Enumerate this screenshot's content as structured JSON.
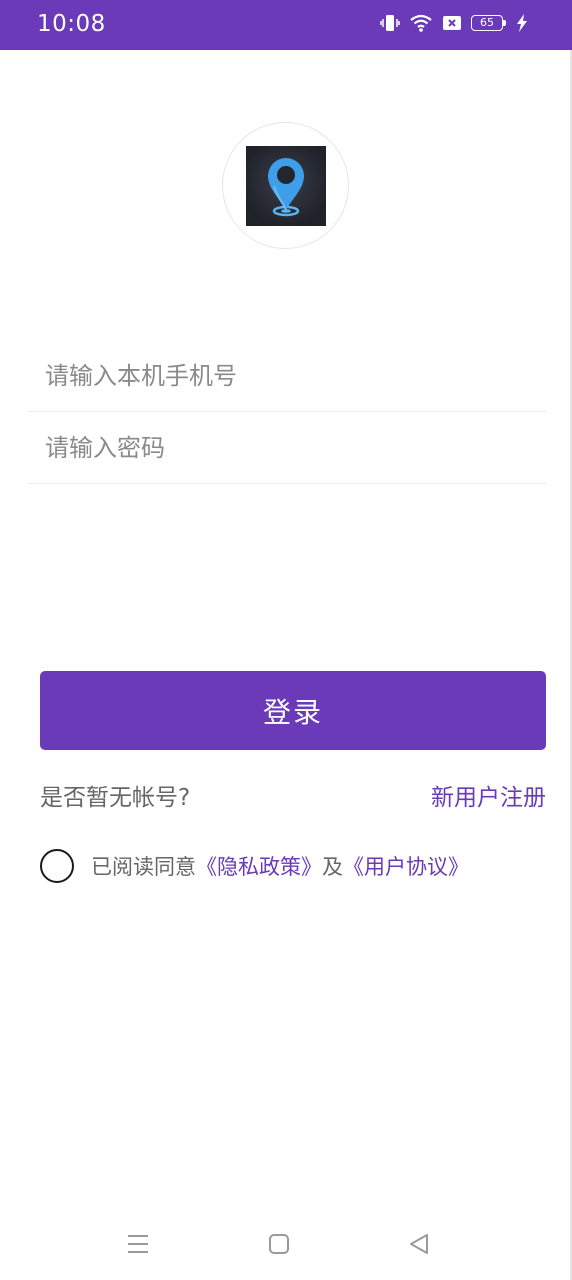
{
  "status_bar": {
    "time": "10:08",
    "battery_level": "65",
    "icons": [
      "vibrate-icon",
      "wifi-icon",
      "sim-off-icon",
      "battery-icon",
      "charging-icon"
    ]
  },
  "logo": {
    "icon": "location-pin-icon"
  },
  "form": {
    "phone_placeholder": "请输入本机手机号",
    "password_placeholder": "请输入密码"
  },
  "login_label": "登录",
  "no_account_text": "是否暂无帐号?",
  "register_label": "新用户注册",
  "agreement": {
    "prefix": "已阅读同意",
    "privacy_link": "《隐私政策》",
    "conjunction": "及",
    "terms_link": "《用户协议》",
    "checked": false
  },
  "nav_bar": {
    "icons": [
      "menu-icon",
      "home-icon",
      "back-icon"
    ]
  },
  "colors": {
    "accent": "#6a3ab8",
    "status_bar": "#6a3ab8"
  }
}
